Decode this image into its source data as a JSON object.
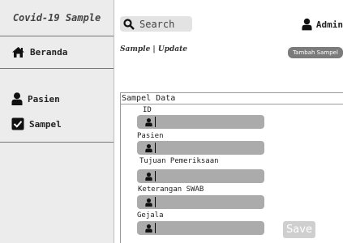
{
  "app": {
    "title": "Covid-19 Sample"
  },
  "sidebar": {
    "items": [
      {
        "label": "Beranda",
        "icon": "home-icon"
      },
      {
        "label": "Pasien",
        "icon": "user-icon"
      },
      {
        "label": "Sampel",
        "icon": "checkbox-icon"
      }
    ]
  },
  "header": {
    "search_label": "Search",
    "search_icon": "search-icon",
    "user_label": "Admin",
    "user_icon": "user-icon"
  },
  "page": {
    "breadcrumb": "Sample | Update",
    "add_button": "Tambah Sampel"
  },
  "form": {
    "title": "Sampel Data",
    "fields": [
      {
        "label": "ID"
      },
      {
        "label": "Pasien"
      },
      {
        "label": "Tujuan Pemeriksaan"
      },
      {
        "label": "Keterangan SWAB"
      },
      {
        "label": "Gejala"
      }
    ],
    "save_label": "Save"
  },
  "colors": {
    "sidebar_bg": "#ececec",
    "button_bg": "#7b7b7b",
    "input_bg": "#ababab",
    "save_bg": "#cfcfcf"
  }
}
